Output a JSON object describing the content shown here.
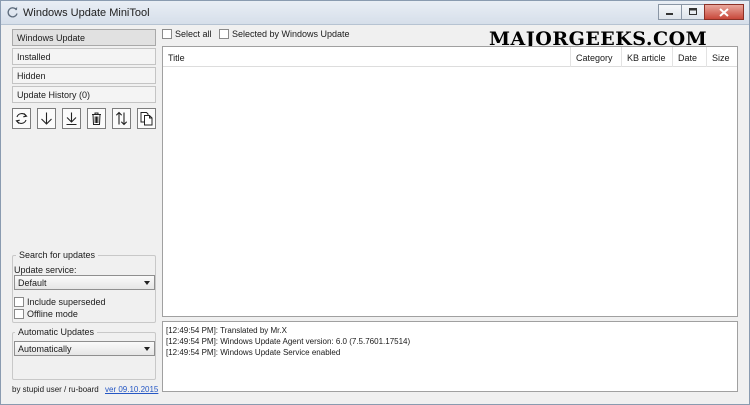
{
  "window": {
    "title": "Windows Update MiniTool"
  },
  "watermark": "MAJORGEEKS.COM",
  "sidebar": {
    "items": [
      {
        "label": "Windows Update",
        "active": true
      },
      {
        "label": "Installed",
        "active": false
      },
      {
        "label": "Hidden",
        "active": false
      },
      {
        "label": "Update History (0)",
        "active": false
      }
    ]
  },
  "toolbar": {
    "buttons": [
      "refresh-icon",
      "download-arrow-icon",
      "install-arrow-icon",
      "trash-icon",
      "up-down-arrows-icon",
      "copy-icon"
    ]
  },
  "search": {
    "group_title": "Search for updates",
    "service_label": "Update service:",
    "service_value": "Default",
    "include_superseded": "Include superseded",
    "offline_mode": "Offline mode"
  },
  "automatic": {
    "group_title": "Automatic Updates",
    "value": "Automatically"
  },
  "footer": {
    "credit": "by stupid user / ru-board",
    "version": "ver 09.10.2015"
  },
  "list": {
    "select_all": "Select all",
    "selected_by_wu": "Selected by Windows Update",
    "columns": [
      "Title",
      "Category",
      "KB article",
      "Date",
      "Size"
    ]
  },
  "log": [
    "[12:49:54 PM]: Translated by Mr.X",
    "[12:49:54 PM]: Windows Update Agent version: 6.0 (7.5.7601.17514)",
    "[12:49:54 PM]: Windows Update Service enabled"
  ],
  "colors": {
    "titlebar": "#dbe3ed",
    "close_button": "#c8483a",
    "link": "#2557c4"
  }
}
